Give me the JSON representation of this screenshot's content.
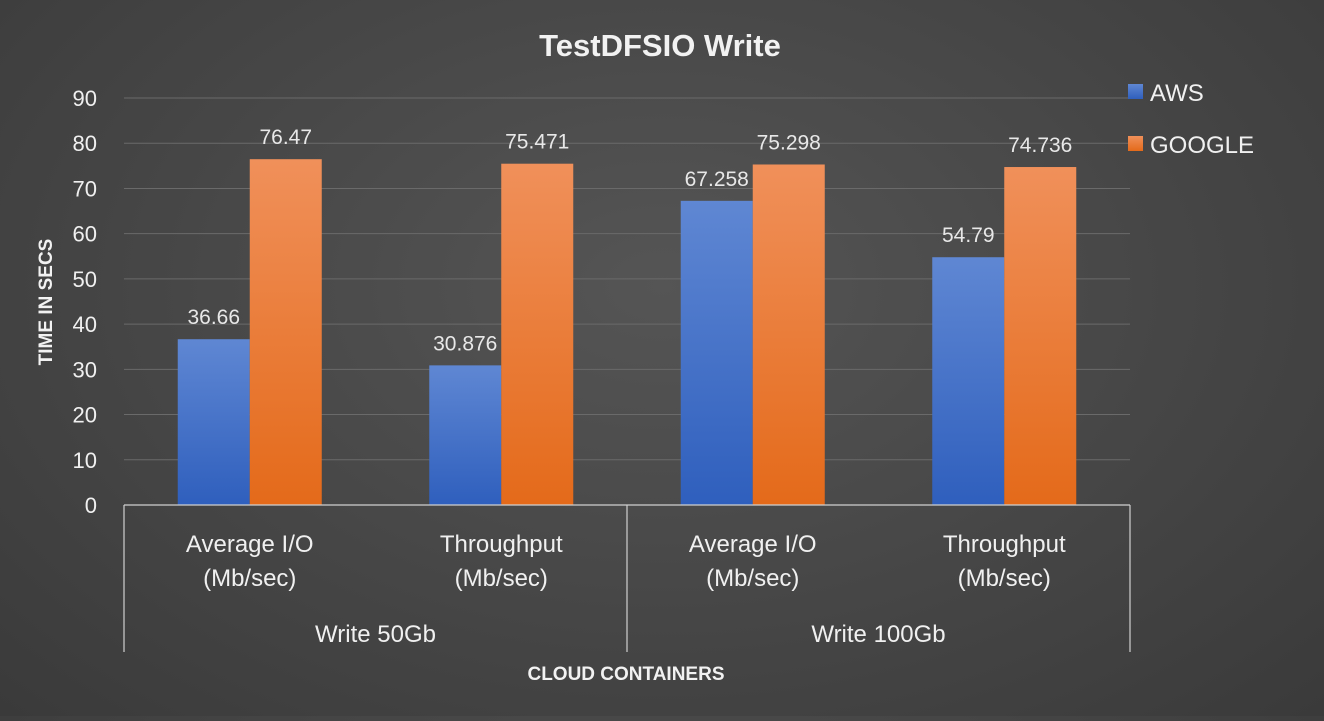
{
  "chart_data": {
    "type": "bar",
    "title": "TestDFSIO Write",
    "ylabel": "TIME IN SECS",
    "xlabel": "CLOUD CONTAINERS",
    "ylim": [
      0,
      90
    ],
    "yticks": [
      0,
      10,
      20,
      30,
      40,
      50,
      60,
      70,
      80,
      90
    ],
    "grid": true,
    "legend_position": "top-right",
    "groups": [
      {
        "label": "Write 50Gb",
        "categories": [
          [
            "Average I/O",
            "(Mb/sec)"
          ],
          [
            "Throughput",
            "(Mb/sec)"
          ]
        ]
      },
      {
        "label": "Write 100Gb",
        "categories": [
          [
            "Average I/O",
            "(Mb/sec)"
          ],
          [
            "Throughput",
            "(Mb/sec)"
          ]
        ]
      }
    ],
    "series": [
      {
        "name": "AWS",
        "color": "#4472C4",
        "values": [
          36.66,
          30.876,
          67.258,
          54.79
        ],
        "labels": [
          "36.66",
          "30.876",
          "67.258",
          "54.79"
        ]
      },
      {
        "name": "GOOGLE",
        "color": "#ED7D31",
        "values": [
          76.47,
          75.471,
          75.298,
          74.736
        ],
        "labels": [
          "76.47",
          "75.471",
          "75.298",
          "74.736"
        ]
      }
    ]
  }
}
